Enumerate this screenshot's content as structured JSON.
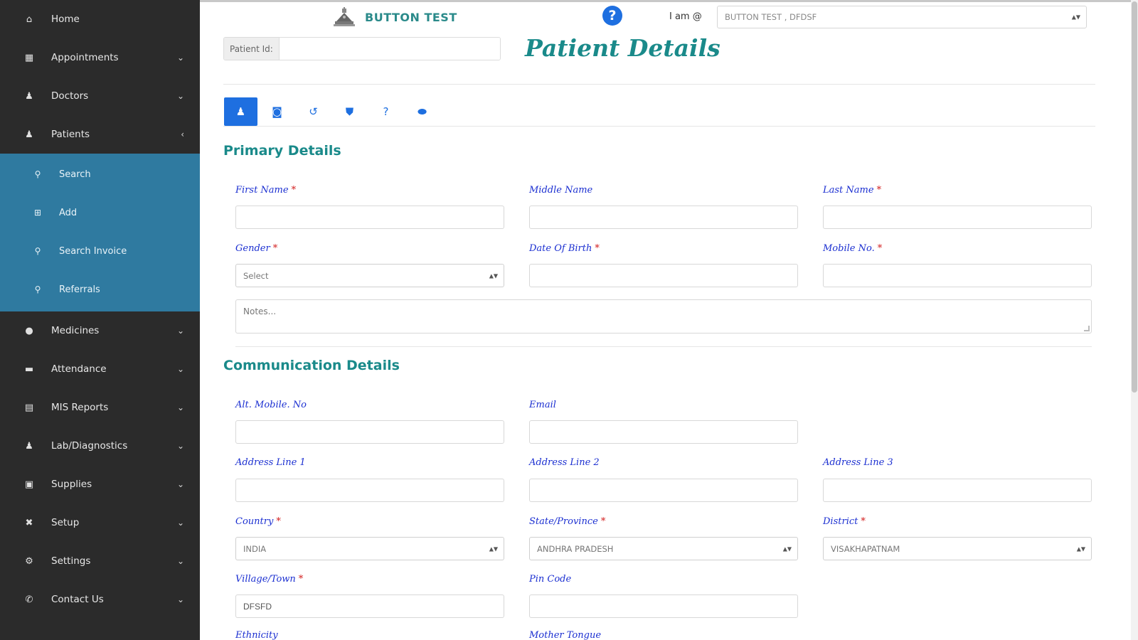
{
  "sidebar": {
    "items": [
      {
        "label": "Home",
        "icon": "home-icon",
        "glyph": "⌂",
        "chevron": ""
      },
      {
        "label": "Appointments",
        "icon": "calendar-icon",
        "glyph": "▦",
        "chevron": "⌄"
      },
      {
        "label": "Doctors",
        "icon": "user-md-icon",
        "glyph": "♟",
        "chevron": "⌄"
      },
      {
        "label": "Patients",
        "icon": "users-icon",
        "glyph": "♟",
        "chevron": "‹"
      }
    ],
    "patients_submenu": [
      {
        "label": "Search",
        "icon": "search-icon",
        "glyph": "⚲"
      },
      {
        "label": "Add",
        "icon": "plus-square-icon",
        "glyph": "⊞"
      },
      {
        "label": "Search Invoice",
        "icon": "search-icon",
        "glyph": "⚲"
      },
      {
        "label": "Referrals",
        "icon": "search-icon",
        "glyph": "⚲"
      }
    ],
    "items_after": [
      {
        "label": "Medicines",
        "icon": "pills-icon",
        "glyph": "●",
        "chevron": "⌄"
      },
      {
        "label": "Attendance",
        "icon": "book-icon",
        "glyph": "▬",
        "chevron": "⌄"
      },
      {
        "label": "MIS Reports",
        "icon": "file-icon",
        "glyph": "▤",
        "chevron": "⌄"
      },
      {
        "label": "Lab/Diagnostics",
        "icon": "lab-user-icon",
        "glyph": "♟",
        "chevron": "⌄"
      },
      {
        "label": "Supplies",
        "icon": "box-icon",
        "glyph": "▣",
        "chevron": "⌄"
      },
      {
        "label": "Setup",
        "icon": "tools-icon",
        "glyph": "✖",
        "chevron": "⌄"
      },
      {
        "label": "Settings",
        "icon": "gear-icon",
        "glyph": "⚙",
        "chevron": "⌄"
      },
      {
        "label": "Contact Us",
        "icon": "phone-icon",
        "glyph": "✆",
        "chevron": "⌄"
      }
    ]
  },
  "header": {
    "brand_name": "BUTTON TEST",
    "help_glyph": "?",
    "iam_label": "I am @",
    "clinic_value": "BUTTON TEST , DFDSF",
    "patient_id_label": "Patient Id:",
    "patient_id_value": "",
    "page_title": "Patient Details"
  },
  "tabs": [
    {
      "icon": "user-icon",
      "glyph": "♟",
      "active": true
    },
    {
      "icon": "camera-icon",
      "glyph": "◙",
      "active": false
    },
    {
      "icon": "history-icon",
      "glyph": "↺",
      "active": false
    },
    {
      "icon": "shield-icon",
      "glyph": "⛊",
      "active": false
    },
    {
      "icon": "question-icon",
      "glyph": "?",
      "active": false
    },
    {
      "icon": "handshake-icon",
      "glyph": "⬬",
      "active": false
    }
  ],
  "primary": {
    "title": "Primary Details",
    "first_name": {
      "label": "First Name",
      "required": "*",
      "value": ""
    },
    "middle_name": {
      "label": "Middle Name",
      "value": ""
    },
    "last_name": {
      "label": "Last Name",
      "required": "*",
      "value": ""
    },
    "gender": {
      "label": "Gender",
      "required": "*",
      "value": "Select"
    },
    "dob": {
      "label": "Date Of Birth",
      "required": "*",
      "value": ""
    },
    "mobile": {
      "label": "Mobile No.",
      "required": "*",
      "value": ""
    },
    "notes_placeholder": "Notes..."
  },
  "communication": {
    "title": "Communication Details",
    "alt_mobile": {
      "label": "Alt. Mobile. No",
      "value": ""
    },
    "email": {
      "label": "Email",
      "value": ""
    },
    "address1": {
      "label": "Address Line 1",
      "value": ""
    },
    "address2": {
      "label": "Address Line 2",
      "value": ""
    },
    "address3": {
      "label": "Address Line 3",
      "value": ""
    },
    "country": {
      "label": "Country",
      "required": "*",
      "value": "INDIA"
    },
    "state": {
      "label": "State/Province",
      "required": "*",
      "value": "ANDHRA PRADESH"
    },
    "district": {
      "label": "District",
      "required": "*",
      "value": "VISAKHAPATNAM"
    },
    "village": {
      "label": "Village/Town",
      "required": "*",
      "value": "DFSFD"
    },
    "pincode": {
      "label": "Pin Code",
      "value": ""
    },
    "ethnicity": {
      "label": "Ethnicity"
    },
    "mother_tongue": {
      "label": "Mother Tongue"
    }
  },
  "colors": {
    "sidebar_bg": "#2b2b2b",
    "submenu_bg": "#2f7aa0",
    "teal": "#1a8a8a",
    "primary_blue": "#1e6fe0",
    "label_blue": "#1b2fd1",
    "required_red": "#d21c1c"
  }
}
